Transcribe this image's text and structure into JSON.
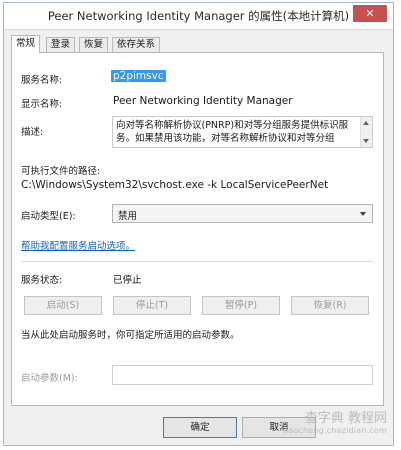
{
  "window": {
    "title": "Peer Networking Identity Manager 的属性(本地计算机)",
    "close_glyph": "✕"
  },
  "tabs": [
    {
      "label": "常规",
      "active": true
    },
    {
      "label": "登录",
      "active": false
    },
    {
      "label": "恢复",
      "active": false
    },
    {
      "label": "依存关系",
      "active": false
    }
  ],
  "general": {
    "service_name_label": "服务名称:",
    "service_name": "p2pimsvc",
    "display_name_label": "显示名称:",
    "display_name": "Peer Networking Identity Manager",
    "description_label": "描述:",
    "description": "向对等名称解析协议(PNRP)和对等分组服务提供标识服务。如果禁用该功能，对等名称解析协议和对等分组",
    "path_label": "可执行文件的路径:",
    "path": "C:\\Windows\\System32\\svchost.exe -k LocalServicePeerNet",
    "startup_type_label": "启动类型(E):",
    "startup_type": "禁用",
    "help_link": "帮助我配置服务启动选项。",
    "status_label": "服务状态:",
    "status": "已停止",
    "buttons": {
      "start": "启动(S)",
      "stop": "停止(T)",
      "pause": "暂停(P)",
      "resume": "恢复(R)"
    },
    "start_hint": "当从此处启动服务时，你可指定所适用的启动参数。",
    "params_label": "启动参数(M):",
    "params_value": ""
  },
  "dialog_buttons": {
    "ok": "确定",
    "cancel": "取消"
  },
  "watermark": {
    "line1": "查字典 教程网",
    "line2": "jiaocheng.chazidian.com"
  },
  "colors": {
    "highlight": "#3399ff",
    "link": "#0b62c4",
    "close_button": "#c75050",
    "dialog_background": "#f0f0f0",
    "disabled_text": "#9a9a9a"
  }
}
